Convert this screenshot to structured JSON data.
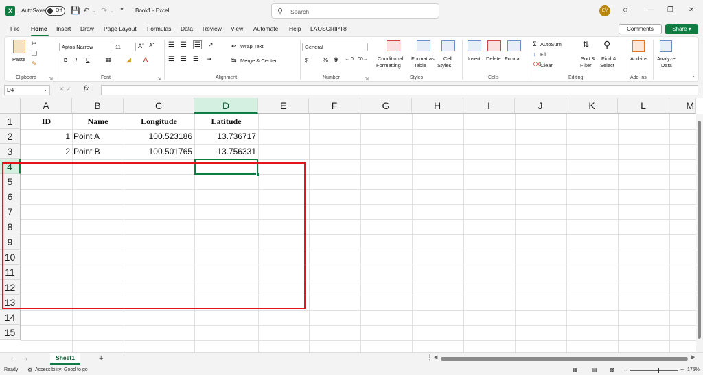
{
  "titlebar": {
    "app_logo": "X",
    "autosave_label": "AutoSave",
    "autosave_state": "Off",
    "doc_title": "Book1  -  Excel",
    "search_placeholder": "Search",
    "avatar_initials": "EV"
  },
  "menu": {
    "items": [
      "File",
      "Home",
      "Insert",
      "Draw",
      "Page Layout",
      "Formulas",
      "Data",
      "Review",
      "View",
      "Automate",
      "Help",
      "LAOSCRIPT8"
    ],
    "active": "Home",
    "comments_label": "Comments",
    "share_label": "Share"
  },
  "ribbon": {
    "clipboard": {
      "paste_label": "Paste",
      "group_label": "Clipboard"
    },
    "font": {
      "font_name": "Aptos Narrow",
      "font_size": "11",
      "bold": "B",
      "italic": "I",
      "underline": "U",
      "group_label": "Font"
    },
    "alignment": {
      "wrap_text": "Wrap Text",
      "merge_center": "Merge & Center",
      "group_label": "Alignment"
    },
    "number": {
      "format": "General",
      "currency": "$",
      "percent": "%",
      "comma": "9",
      "group_label": "Number"
    },
    "styles": {
      "conditional_formatting_1": "Conditional",
      "conditional_formatting_2": "Formatting",
      "format_as_table_1": "Format as",
      "format_as_table_2": "Table",
      "cell_styles_1": "Cell",
      "cell_styles_2": "Styles",
      "group_label": "Styles"
    },
    "cells": {
      "insert": "Insert",
      "delete": "Delete",
      "format": "Format",
      "group_label": "Cells"
    },
    "editing": {
      "autosum": "AutoSum",
      "fill": "Fill",
      "clear": "Clear",
      "sort_filter_1": "Sort &",
      "sort_filter_2": "Filter",
      "find_select_1": "Find &",
      "find_select_2": "Select",
      "group_label": "Editing"
    },
    "addins": {
      "addins_label": "Add-ins",
      "group_label": "Add-ins"
    },
    "analyze": {
      "label_1": "Analyze",
      "label_2": "Data"
    }
  },
  "formula_bar": {
    "name_box": "D4",
    "fx": "fx",
    "formula": ""
  },
  "sheet": {
    "columns": [
      "A",
      "B",
      "C",
      "D",
      "E",
      "F",
      "G",
      "H",
      "I",
      "J",
      "K",
      "L",
      "M"
    ],
    "rows": [
      "1",
      "2",
      "3",
      "4",
      "5",
      "6",
      "7",
      "8",
      "9",
      "10",
      "11",
      "12",
      "13",
      "14",
      "15"
    ],
    "selected_column": "D",
    "selected_row": "4",
    "headers": [
      "ID",
      "Name",
      "Longitude",
      "Latitude"
    ],
    "data": [
      {
        "id": "1",
        "name": "Point A",
        "longitude": "100.523186",
        "latitude": "13.736717"
      },
      {
        "id": "2",
        "name": "Point B",
        "longitude": "100.501765",
        "latitude": "13.756331"
      }
    ]
  },
  "tabs": {
    "sheets": [
      "Sheet1"
    ],
    "add": "+"
  },
  "status": {
    "ready": "Ready",
    "accessibility": "Accessibility: Good to go",
    "zoom": "175%"
  },
  "colors": {
    "accent": "#107c41",
    "highlight": "#e3141b"
  }
}
